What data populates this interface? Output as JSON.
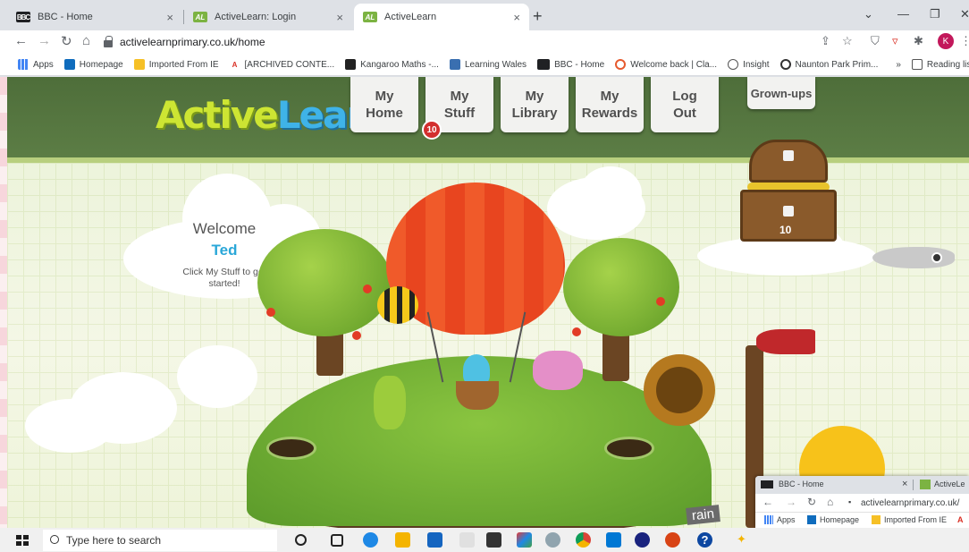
{
  "browser": {
    "tabs": [
      {
        "title": "BBC - Home",
        "favicon": "BBC",
        "active": false
      },
      {
        "title": "ActiveLearn: Login",
        "favicon": "AL",
        "active": false
      },
      {
        "title": "ActiveLearn",
        "favicon": "AL",
        "active": true
      }
    ],
    "close_glyph": "×",
    "new_tab_glyph": "+",
    "url": "activelearnprimary.co.uk/home",
    "profile_initial": "K",
    "bookmarks": [
      {
        "label": "Apps",
        "icon": "apps-grid-icon"
      },
      {
        "label": "Homepage",
        "icon": "outlook-icon"
      },
      {
        "label": "Imported From IE",
        "icon": "folder-icon"
      },
      {
        "label": "[ARCHIVED CONTE...",
        "icon": "archive-icon"
      },
      {
        "label": "Kangaroo Maths -...",
        "icon": "kangaroo-icon"
      },
      {
        "label": "Learning Wales",
        "icon": "wales-icon"
      },
      {
        "label": "BBC - Home",
        "icon": "bbc-icon"
      },
      {
        "label": "Welcome back | Cla...",
        "icon": "class-icon"
      },
      {
        "label": "Insight",
        "icon": "insight-icon"
      },
      {
        "label": "Naunton Park Prim...",
        "icon": "school-icon"
      }
    ],
    "bookmarks_more": "»",
    "reading_list": "Reading list"
  },
  "page": {
    "logo_part1": "Active",
    "logo_part2": "Learn",
    "nav": [
      {
        "label": "My\nHome"
      },
      {
        "label": "My\nStuff"
      },
      {
        "label": "My\nLibrary"
      },
      {
        "label": "My\nRewards"
      },
      {
        "label": "Log\nOut"
      }
    ],
    "stuff_badge": "10",
    "grownups": "Grown-ups",
    "welcome": {
      "greeting": "Welcome",
      "name": "Ted",
      "hint": "Click My Stuff to get started!"
    },
    "chest_count": "10",
    "rain_label": "rain"
  },
  "second_window": {
    "tab1": "BBC - Home",
    "tab2": "ActiveLe",
    "url": "activelearnprimary.co.uk/",
    "bm_apps": "Apps",
    "bm_home": "Homepage",
    "bm_ie": "Imported From IE",
    "bm_a": "A"
  },
  "taskbar": {
    "search_placeholder": "Type here to search"
  }
}
